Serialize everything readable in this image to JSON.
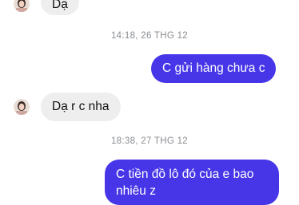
{
  "conversation": {
    "messages": [
      {
        "direction": "incoming",
        "text": "Dạ"
      },
      {
        "direction": "outgoing",
        "text": "C gửi hàng chưa c"
      },
      {
        "direction": "incoming",
        "text": "Dạ r c nha"
      },
      {
        "direction": "outgoing",
        "text": "C tiền đồ lô đó của e bao nhiêu z",
        "line1": "C tiền đồ lô đó của e bao",
        "line2": "nhiêu z"
      }
    ],
    "timestamps": [
      "14:18, 26 THG 12",
      "18:38, 27 THG 12"
    ]
  },
  "colors": {
    "outgoing_bubble": "#4736e8",
    "incoming_bubble": "#eeeeee",
    "timestamp_text": "#8a8d91"
  },
  "icons": {
    "avatar": "contact-avatar"
  }
}
